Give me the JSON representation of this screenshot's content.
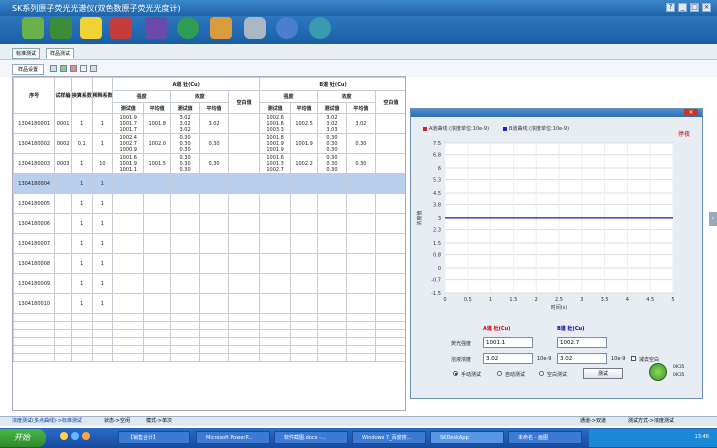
{
  "window": {
    "title": "SK系列原子荧光光谱仪(双色数原子荧光光度计)"
  },
  "tabs": [
    "标准测试",
    "样品测试"
  ],
  "subbar": {
    "button": "样品设置"
  },
  "table": {
    "headers": {
      "seq": "序号",
      "sample_no": "试样编号",
      "factor": "换算系数",
      "dilution": "稀释系数",
      "a_channel": "A道 钍(Cu)",
      "b_channel": "B道 钍(Cu)",
      "intensity": "强度",
      "concentration": "浓度",
      "measured": "测试值",
      "avg": "平均值",
      "blank": "空白值"
    },
    "rows": [
      {
        "seq": "1304180001",
        "no": "0001",
        "factor": "1",
        "dil": "1",
        "a_meas": [
          "1001.9",
          "1001.7",
          "1001.7"
        ],
        "a_avg": "1001.8",
        "a_conc": [
          "3.02",
          "3.02",
          "3.02"
        ],
        "a_cavg": "3.02",
        "b_meas": [
          "1002.6",
          "1001.6",
          "1003.3"
        ],
        "b_avg": "1002.5",
        "b_conc": [
          "3.02",
          "3.02",
          "3.03"
        ],
        "b_cavg": "3.02"
      },
      {
        "seq": "1304180002",
        "no": "0002",
        "factor": "0.1",
        "dil": "1",
        "a_meas": [
          "1002.4",
          "1002.7",
          "1000.9"
        ],
        "a_avg": "1002.0",
        "a_conc": [
          "0.30",
          "0.30",
          "0.30"
        ],
        "a_cavg": "0.30",
        "b_meas": [
          "1001.8",
          "1001.9",
          "1001.9"
        ],
        "b_avg": "1001.9",
        "b_conc": [
          "0.30",
          "0.30",
          "0.30"
        ],
        "b_cavg": "0.30"
      },
      {
        "seq": "1304180003",
        "no": "0003",
        "factor": "1",
        "dil": "10",
        "a_meas": [
          "1001.6",
          "1001.9",
          "1001.1"
        ],
        "a_avg": "1001.5",
        "a_conc": [
          "0.30",
          "0.30",
          "0.30"
        ],
        "a_cavg": "0.30",
        "b_meas": [
          "1001.6",
          "1001.3",
          "1002.7"
        ],
        "b_avg": "1002.2",
        "b_conc": [
          "0.30",
          "0.30",
          "0.30"
        ],
        "b_cavg": "0.30"
      },
      {
        "seq": "1304180004",
        "no": "",
        "factor": "1",
        "dil": "1",
        "sel": true
      },
      {
        "seq": "1304180005",
        "no": "",
        "factor": "1",
        "dil": "1"
      },
      {
        "seq": "1304180006",
        "no": "",
        "factor": "1",
        "dil": "1"
      },
      {
        "seq": "1304180007",
        "no": "",
        "factor": "1",
        "dil": "1"
      },
      {
        "seq": "1304180008",
        "no": "",
        "factor": "1",
        "dil": "1"
      },
      {
        "seq": "1304180009",
        "no": "",
        "factor": "1",
        "dil": "1"
      },
      {
        "seq": "1304180010",
        "no": "",
        "factor": "1",
        "dil": "1"
      }
    ]
  },
  "panel": {
    "legend_a": "A道曲线 (浓度单位:10e-9)",
    "legend_b": "B道曲线 (浓度单位:10e-9)",
    "stop": "停夜",
    "a_label": "A道 钍(Cu)",
    "b_label": "B道 钍(Cu)",
    "intensity_label": "荧光强度",
    "intensity_a": "1001.1",
    "intensity_b": "1002.7",
    "conc_label": "溶液浓度",
    "conc_a": "3.02",
    "conc_b": "3.02",
    "unit": "10e-9",
    "deduct_blank": "减去空白",
    "manual": "手动测试",
    "auto": "自动测试",
    "blank_test": "空白测试",
    "test_button": "测试",
    "gauge_a": "0K35",
    "gauge_b": "0K35"
  },
  "chart_data": {
    "type": "line",
    "xlabel": "时间(s)",
    "ylabel": "浓度值",
    "xlim": [
      0,
      5
    ],
    "ylim": [
      -1.5,
      7.5
    ],
    "x_ticks": [
      "0",
      "0.5",
      "1",
      "1.5",
      "2",
      "2.5",
      "3",
      "3.5",
      "4",
      "4.5",
      "5"
    ],
    "y_ticks": [
      "7.5",
      "6.8",
      "6",
      "5.3",
      "4.5",
      "3.8",
      "3",
      "2.3",
      "1.5",
      "0.8",
      "0",
      "-0.7",
      "-1.5"
    ],
    "series": [
      {
        "name": "A道曲线",
        "color": "#cc2222",
        "x": [
          0,
          5
        ],
        "y": [
          3.02,
          3.02
        ]
      },
      {
        "name": "B道曲线",
        "color": "#2222cc",
        "x": [
          0,
          5
        ],
        "y": [
          3.0,
          3.0
        ]
      }
    ]
  },
  "status": {
    "left": "浓度测试(多点曲线)->标准测试",
    "mid1": "状态->空闲",
    "mid2": "模式->单次",
    "right1": "通道->双道",
    "right2": "测试方式->浓度测试"
  },
  "taskbar": {
    "start": "开始",
    "items": [
      "【销售合计】",
      "Microsoft PowerP...",
      "软件截图.docx -...",
      "Windows 7_百度搜...",
      "SKDeskApp",
      "未命名 - 画图"
    ],
    "time": "13:46"
  }
}
